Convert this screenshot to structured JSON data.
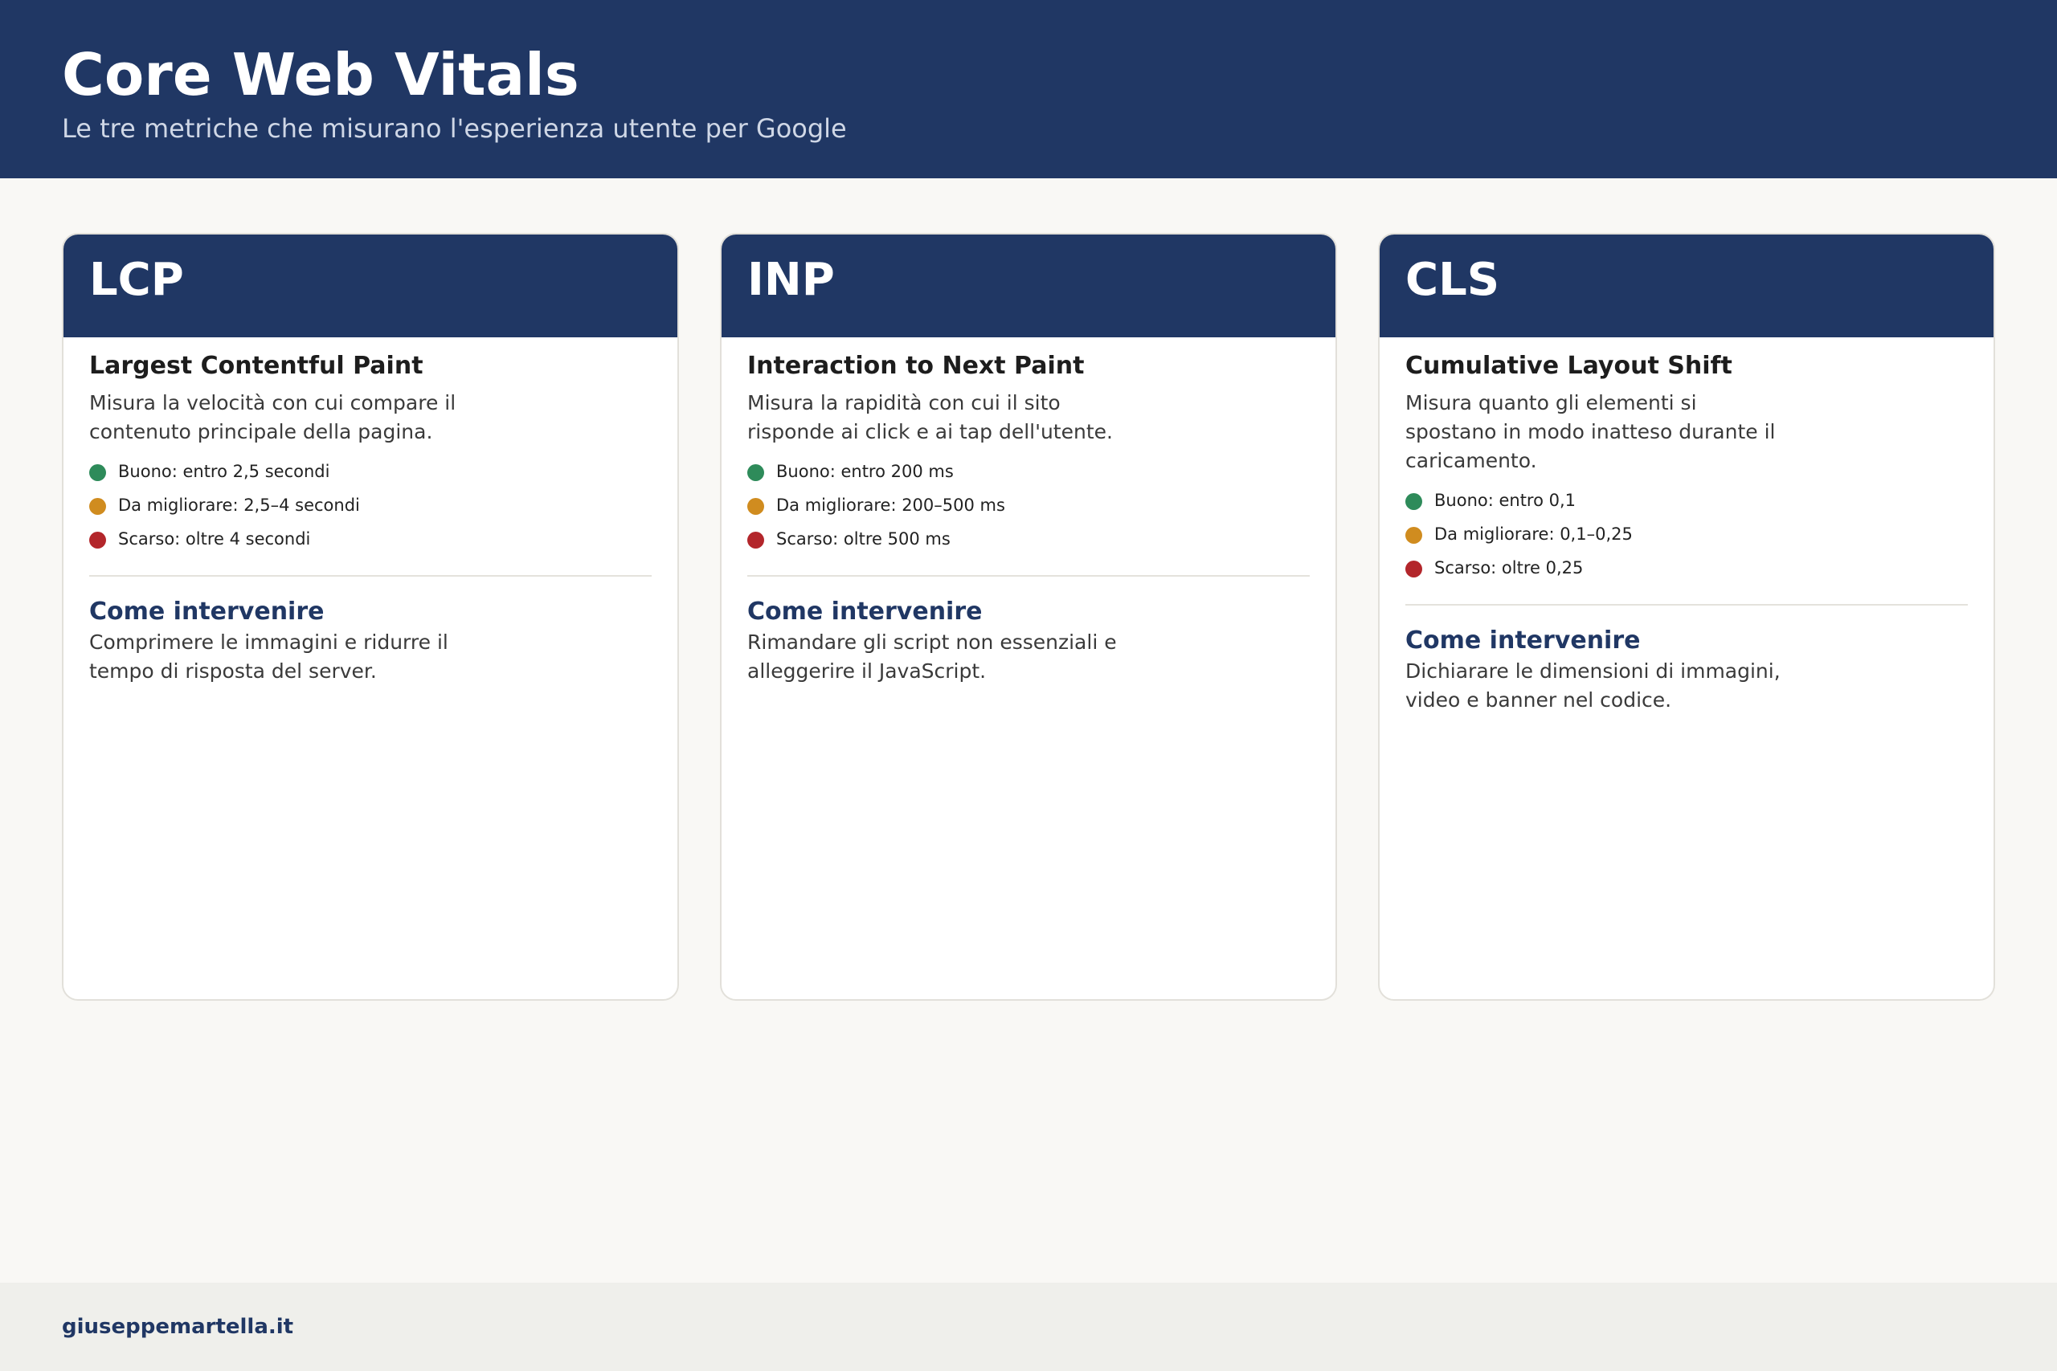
{
  "header": {
    "title": "Core Web Vitals",
    "subtitle": "Le tre metriche che misurano l'esperienza utente per Google",
    "background": "#203764"
  },
  "colors": {
    "good": "#2e8b5a",
    "improve": "#d08c1f",
    "poor": "#b3262b",
    "accent": "#203764"
  },
  "cards": [
    {
      "abbr": "LCP",
      "name": "Largest Contentful Paint",
      "description": "Misura la velocità con cui compare il contenuto principale della pagina.",
      "thresholds": [
        {
          "label": "Buono: entro 2,5 secondi",
          "status": "good"
        },
        {
          "label": "Da migliorare: 2,5–4 secondi",
          "status": "improve"
        },
        {
          "label": "Scarso: oltre 4 secondi",
          "status": "poor"
        }
      ],
      "action_title": "Come intervenire",
      "action_text": "Comprimere le immagini e ridurre il tempo di risposta del server."
    },
    {
      "abbr": "INP",
      "name": "Interaction to Next Paint",
      "description": "Misura la rapidità con cui il sito risponde ai click e ai tap dell'utente.",
      "thresholds": [
        {
          "label": "Buono: entro 200 ms",
          "status": "good"
        },
        {
          "label": "Da migliorare: 200–500 ms",
          "status": "improve"
        },
        {
          "label": "Scarso: oltre 500 ms",
          "status": "poor"
        }
      ],
      "action_title": "Come intervenire",
      "action_text": "Rimandare gli script non essenziali e alleggerire il JavaScript."
    },
    {
      "abbr": "CLS",
      "name": "Cumulative Layout Shift",
      "description": "Misura quanto gli elementi si spostano in modo inatteso durante il caricamento.",
      "thresholds": [
        {
          "label": "Buono: entro 0,1",
          "status": "good"
        },
        {
          "label": "Da migliorare: 0,1–0,25",
          "status": "improve"
        },
        {
          "label": "Scarso: oltre 0,25",
          "status": "poor"
        }
      ],
      "action_title": "Come intervenire",
      "action_text": "Dichiarare le dimensioni di immagini, video e banner nel codice."
    }
  ],
  "footer": {
    "brand": "giuseppemartella.it"
  }
}
